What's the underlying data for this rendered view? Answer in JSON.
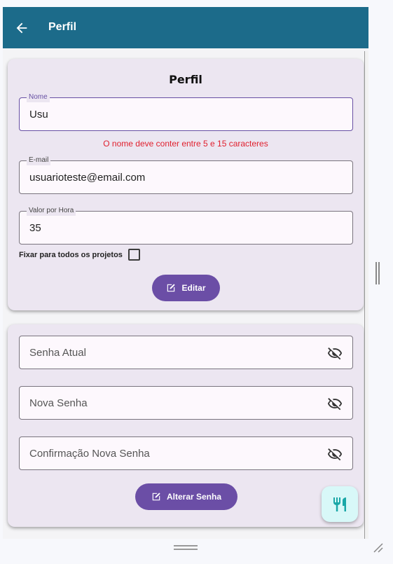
{
  "appbar": {
    "title": "Perfil",
    "back_icon": "arrow-left-icon",
    "color": "#1c6b8a"
  },
  "profile_card": {
    "title": "Perfil",
    "name_field": {
      "label": "Nome",
      "value": "Usu"
    },
    "name_error": "O nome deve conter entre 5 e 15 caracteres",
    "email_field": {
      "label": "E-mail",
      "value": "usuarioteste@email.com"
    },
    "rate_field": {
      "label": "Valor por Hora",
      "value": "35"
    },
    "fix_all_projects": {
      "label": "Fixar para todos os projetos",
      "checked": false
    },
    "edit_button": {
      "label": "Editar",
      "icon": "edit-icon"
    }
  },
  "password_card": {
    "current_password": {
      "placeholder": "Senha Atual",
      "icon": "eye-off-icon"
    },
    "new_password": {
      "placeholder": "Nova Senha",
      "icon": "eye-off-icon"
    },
    "confirm_password": {
      "placeholder": "Confirmação Nova Senha",
      "icon": "eye-off-icon"
    },
    "change_button": {
      "label": "Alterar Senha",
      "icon": "edit-icon"
    }
  },
  "fab": {
    "icon": "restaurant-icon"
  },
  "colors": {
    "primary": "#6b4ea6",
    "error": "#e0202e",
    "card": "#ece6f1",
    "fab": "#d8f8f8"
  }
}
